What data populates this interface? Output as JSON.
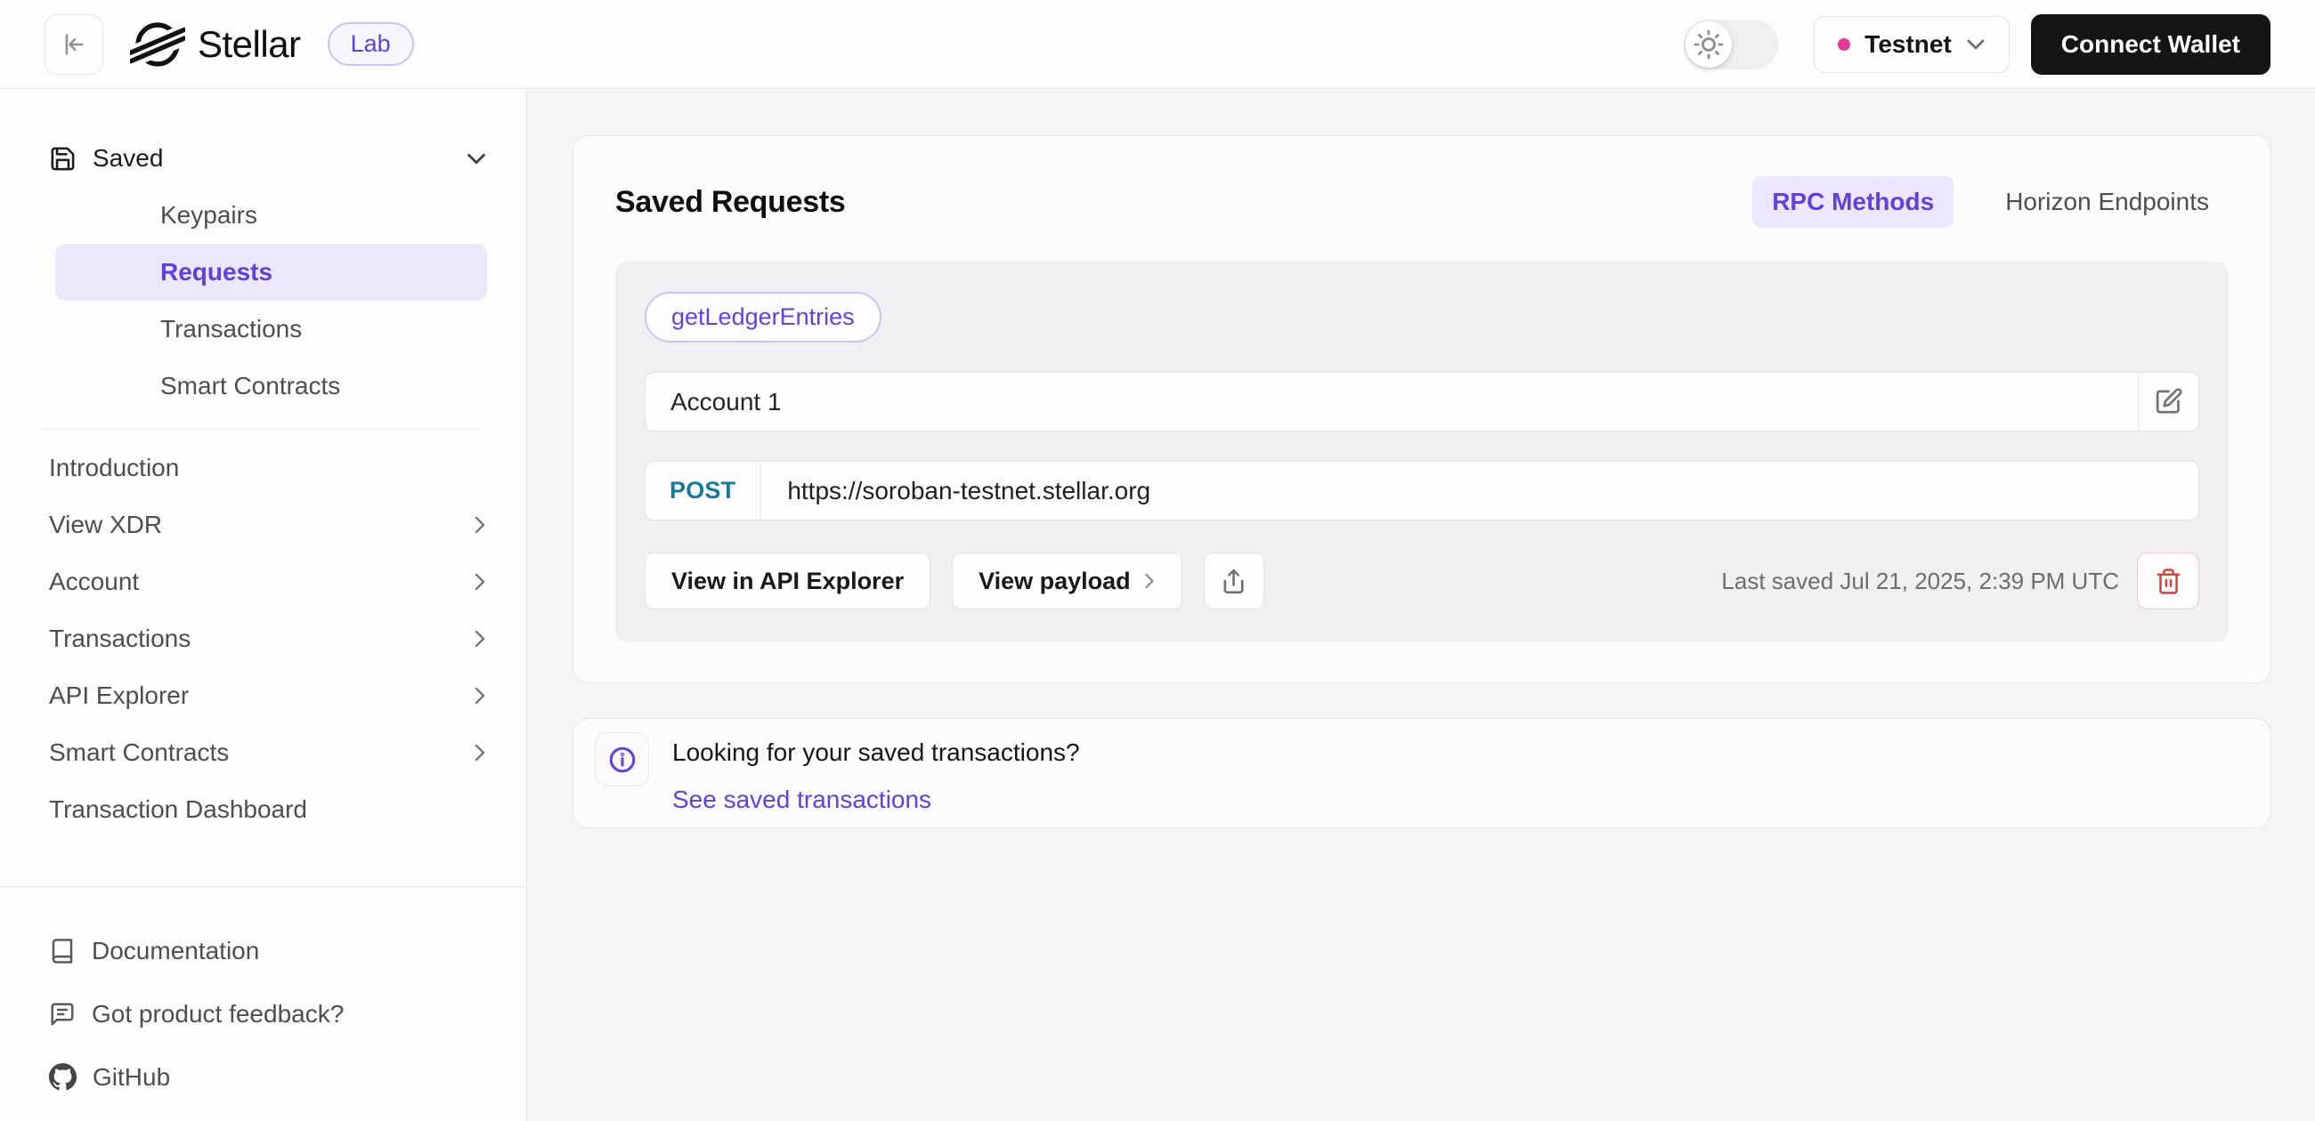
{
  "header": {
    "brand": "Stellar",
    "product_badge": "Lab",
    "network": "Testnet",
    "connect_wallet": "Connect Wallet"
  },
  "sidebar": {
    "saved": {
      "label": "Saved",
      "items": [
        {
          "label": "Keypairs",
          "active": false
        },
        {
          "label": "Requests",
          "active": true
        },
        {
          "label": "Transactions",
          "active": false
        },
        {
          "label": "Smart Contracts",
          "active": false
        }
      ]
    },
    "nav": [
      {
        "label": "Introduction",
        "has_submenu": false
      },
      {
        "label": "View XDR",
        "has_submenu": true
      },
      {
        "label": "Account",
        "has_submenu": true
      },
      {
        "label": "Transactions",
        "has_submenu": true
      },
      {
        "label": "API Explorer",
        "has_submenu": true
      },
      {
        "label": "Smart Contracts",
        "has_submenu": true
      },
      {
        "label": "Transaction Dashboard",
        "has_submenu": false
      }
    ],
    "footer": [
      {
        "label": "Documentation"
      },
      {
        "label": "Got product feedback?"
      },
      {
        "label": "GitHub"
      }
    ]
  },
  "main": {
    "title": "Saved Requests",
    "tabs": [
      {
        "label": "RPC Methods",
        "active": true
      },
      {
        "label": "Horizon Endpoints",
        "active": false
      }
    ],
    "request": {
      "method": "getLedgerEntries",
      "name": "Account 1",
      "http_method": "POST",
      "url": "https://soroban-testnet.stellar.org",
      "view_in_api_explorer": "View in API Explorer",
      "view_payload": "View payload",
      "last_saved": "Last saved Jul 21, 2025, 2:39 PM UTC"
    },
    "info": {
      "title": "Looking for your saved transactions?",
      "link": "See saved transactions"
    }
  },
  "colors": {
    "accent_purple": "#6140df",
    "accent_purple_bg": "#ece7fd",
    "network_dot_pink": "#e23a97",
    "post_method_teal": "#17799b",
    "danger_red": "#d24840",
    "connect_wallet_bg": "#151515"
  }
}
